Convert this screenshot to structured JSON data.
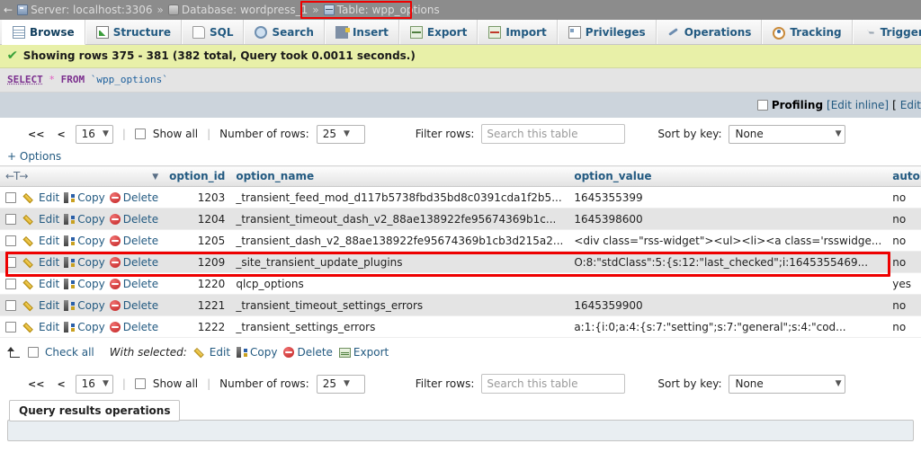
{
  "breadcrumb": {
    "back_arrow": "←",
    "server": "Server: localhost:3306",
    "sep1": "»",
    "database": "Database: wordpress_1",
    "sep2": "»",
    "table": "Table: wpp_options",
    "highlight_color": "#ee0000"
  },
  "tabs": [
    {
      "label": "Browse",
      "icon": "browse-icon",
      "active": true
    },
    {
      "label": "Structure",
      "icon": "structure-icon",
      "active": false
    },
    {
      "label": "SQL",
      "icon": "sql-icon",
      "active": false
    },
    {
      "label": "Search",
      "icon": "search-icon",
      "active": false
    },
    {
      "label": "Insert",
      "icon": "insert-icon",
      "active": false
    },
    {
      "label": "Export",
      "icon": "export-icon",
      "active": false
    },
    {
      "label": "Import",
      "icon": "import-icon",
      "active": false
    },
    {
      "label": "Privileges",
      "icon": "privileges-icon",
      "active": false
    },
    {
      "label": "Operations",
      "icon": "operations-icon",
      "active": false
    },
    {
      "label": "Tracking",
      "icon": "tracking-icon",
      "active": false
    },
    {
      "label": "Triggers",
      "icon": "triggers-icon",
      "active": false
    }
  ],
  "status": {
    "icon": "success-check-icon",
    "message": "Showing rows 375 - 381 (382 total, Query took 0.0011 seconds.)"
  },
  "sql": {
    "select": "SELECT",
    "star": "*",
    "from": "FROM",
    "table": "`wpp_options`"
  },
  "toolbelt": {
    "profiling_label": "Profiling",
    "edit_inline": "[Edit inline]",
    "bracket_open": "[",
    "edit": "Edit"
  },
  "nav": {
    "first": "<<",
    "prev": "<",
    "page_value": "16",
    "show_all_label": "Show all",
    "number_of_rows_label": "Number of rows:",
    "rows_value": "25",
    "filter_rows_label": "Filter rows:",
    "filter_placeholder": "Search this table",
    "sort_by_key_label": "Sort by key:",
    "sort_value": "None",
    "options_link": "+ Options"
  },
  "table": {
    "sort_icon": "←T→",
    "caret_icon": "▼",
    "columns": [
      "option_id",
      "option_name",
      "option_value",
      "autoload"
    ],
    "row_actions": {
      "edit": "Edit",
      "copy": "Copy",
      "delete": "Delete"
    },
    "rows": [
      {
        "option_id": "1203",
        "option_name": "_transient_feed_mod_d117b5738fbd35bd8c0391cda1f2b5...",
        "option_value": "1645355399",
        "autoload": "no",
        "highlighted": false
      },
      {
        "option_id": "1204",
        "option_name": "_transient_timeout_dash_v2_88ae138922fe95674369b1c...",
        "option_value": "1645398600",
        "autoload": "no",
        "highlighted": false
      },
      {
        "option_id": "1205",
        "option_name": "_transient_dash_v2_88ae138922fe95674369b1cb3d215a2...",
        "option_value": "<div class=\"rss-widget\"><ul><li><a class='rsswidge...",
        "autoload": "no",
        "highlighted": false
      },
      {
        "option_id": "1209",
        "option_name": "_site_transient_update_plugins",
        "option_value": "O:8:\"stdClass\":5:{s:12:\"last_checked\";i:1645355469...",
        "autoload": "no",
        "highlighted": false
      },
      {
        "option_id": "1220",
        "option_name": "qlcp_options",
        "option_value": "",
        "autoload": "yes",
        "highlighted": true
      },
      {
        "option_id": "1221",
        "option_name": "_transient_timeout_settings_errors",
        "option_value": "1645359900",
        "autoload": "no",
        "highlighted": false
      },
      {
        "option_id": "1222",
        "option_name": "_transient_settings_errors",
        "option_value": "a:1:{i:0;a:4:{s:7:\"setting\";s:7:\"general\";s:4:\"cod...",
        "autoload": "no",
        "highlighted": false
      }
    ]
  },
  "check_bar": {
    "arrow_icon": "up-left-arrow-icon",
    "check_all_label": "Check all",
    "with_selected_label": "With selected:",
    "edit": "Edit",
    "copy": "Copy",
    "delete": "Delete",
    "export": "Export"
  },
  "footer": {
    "legend": "Query results operations"
  }
}
